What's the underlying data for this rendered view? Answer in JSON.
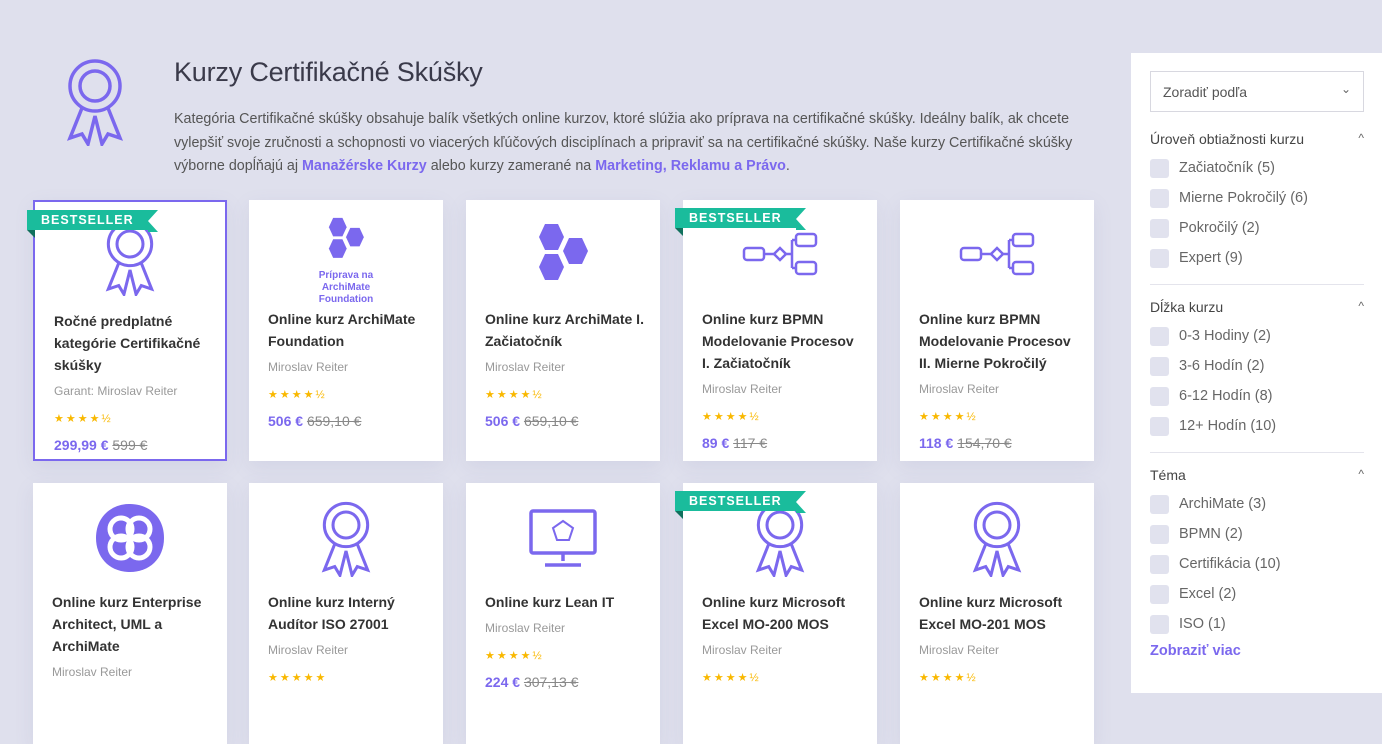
{
  "header": {
    "title": "Kurzy Certifikačné Skúšky",
    "desc_1": "Kategória Certifikačné skúšky obsahuje balík všetkých online kurzov, ktoré slúžia ako príprava na certifikačné skúšky. Ideálny balík, ak chcete vylepšiť svoje zručnosti a schopnosti vo viacerých kľúčových disciplínach a pripraviť sa na certifikačné skúšky. Naše kurzy Certifikačné skúšky výborne dopĺňajú aj ",
    "link_1": "Manažérske Kurzy",
    "desc_2": " alebo kurzy zamerané na ",
    "link_2": "Marketing, Reklamu a Právo",
    "desc_3": "."
  },
  "badge": "BESTSELLER",
  "cards": [
    {
      "title": "Ročné predplatné kategórie Certifikačné skúšky",
      "author": "Garant: Miroslav Reiter",
      "stars": "★★★★½",
      "rating": 4.5,
      "price": "299,99 €",
      "old": "599 €",
      "icon": "award-icon",
      "best": true
    },
    {
      "title": "Online kurz ArchiMate Foundation",
      "author": "Miroslav Reiter",
      "stars": "★★★★½",
      "rating": 4.5,
      "price": "506 €",
      "old": "659,10 €",
      "icon": "hexagons-icon",
      "icon_text": "Príprava na ArchiMate Foundation"
    },
    {
      "title": "Online kurz ArchiMate I. Začiatočník",
      "author": "Miroslav Reiter",
      "stars": "★★★★½",
      "rating": 4.5,
      "price": "506 €",
      "old": "659,10 €",
      "icon": "hexagons-icon"
    },
    {
      "title": "Online kurz BPMN Modelovanie Procesov I. Začiatočník",
      "author": "Miroslav Reiter",
      "stars": "★★★★½",
      "rating": 4.5,
      "price": "89 €",
      "old": "117 €",
      "icon": "process-icon",
      "best": true
    },
    {
      "title": "Online kurz BPMN Modelovanie Procesov II. Mierne Pokročilý",
      "author": "Miroslav Reiter",
      "stars": "★★★★½",
      "rating": 4.5,
      "price": "118 €",
      "old": "154,70 €",
      "icon": "process-icon"
    },
    {
      "title": "Online kurz Enterprise Architect, UML a ArchiMate",
      "author": "Miroslav Reiter",
      "icon": "enterprise-architect-icon"
    },
    {
      "title": "Online kurz Interný Audítor ISO 27001",
      "author": "Miroslav Reiter",
      "stars": "★★★★★",
      "rating": 5,
      "icon": "award-icon"
    },
    {
      "title": "Online kurz Lean IT",
      "author": "Miroslav Reiter",
      "stars": "★★★★½",
      "rating": 4.5,
      "price": "224 €",
      "old": "307,13 €",
      "icon": "monitor-cycle-icon"
    },
    {
      "title": "Online kurz Microsoft Excel MO-200 MOS",
      "author": "Miroslav Reiter",
      "stars": "★★★★½",
      "rating": 4.5,
      "icon": "award-icon",
      "best": true
    },
    {
      "title": "Online kurz Microsoft Excel MO-201 MOS",
      "author": "Miroslav Reiter",
      "stars": "★★★★½",
      "rating": 4.5,
      "icon": "award-icon"
    }
  ],
  "sidebar": {
    "sort": "Zoradiť podľa",
    "groups": [
      {
        "title": "Úroveň obtiažnosti kurzu",
        "options": [
          "Začiatočník (5)",
          "Mierne Pokročilý (6)",
          "Pokročilý (2)",
          "Expert (9)"
        ]
      },
      {
        "title": "Dĺžka kurzu",
        "options": [
          "0-3 Hodiny (2)",
          "3-6 Hodín (2)",
          "6-12 Hodín (8)",
          "12+ Hodín (10)"
        ]
      },
      {
        "title": "Téma",
        "options": [
          "ArchiMate (3)",
          "BPMN (2)",
          "Certifikácia (10)",
          "Excel (2)",
          "ISO (1)"
        ]
      }
    ],
    "more": "Zobraziť viac"
  },
  "colors": {
    "accent": "#7b68ee",
    "badge": "#1abc9c",
    "stars": "#f9b800"
  }
}
